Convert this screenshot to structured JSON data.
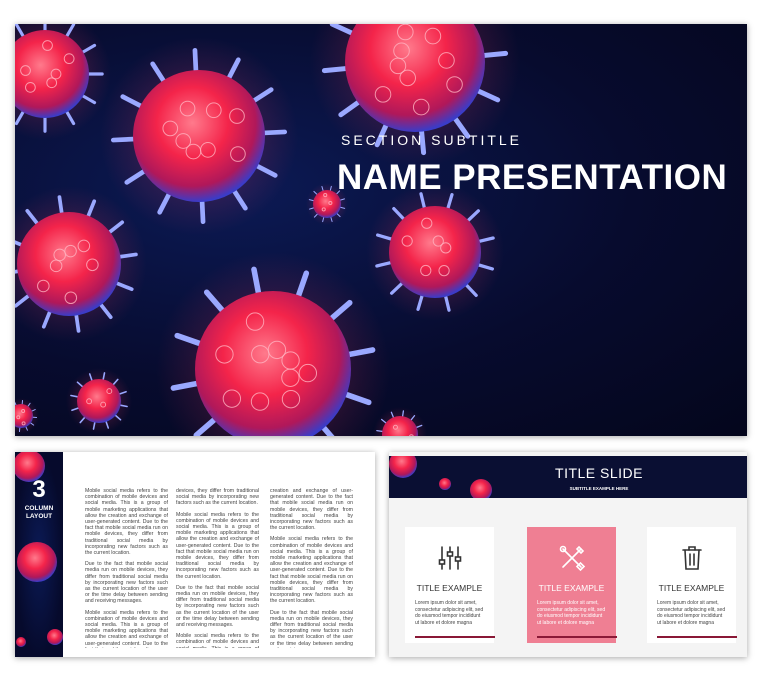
{
  "main_slide": {
    "subtitle": "SECTION SUBTITLE",
    "title": "NAME PRESENTATION"
  },
  "columns_slide": {
    "number": "3",
    "caption_line1": "COLUMN",
    "caption_line2": "LAYOUT",
    "columns": [
      [
        "Mobile social media refers to the combination of mobile devices and social media. This is a group of mobile marketing applications that allow the creation and exchange of user-generated content. Due to the fact that mobile social media run on mobile devices, they differ from traditional social media by incorporating new factors such as the current location.",
        "Due to the fact that mobile social media run on mobile devices, they differ from traditional social media by incorporating new factors such as the current location of the user or the time delay between sending and receiving messages.",
        "Mobile social media refers to the combination of mobile devices and social media. This is a group of mobile marketing applications that allow the creation and exchange of user-generated content. Due to the fact that mobile social media run on mobile"
      ],
      [
        "devices, they differ from traditional social media by incorporating new factors such as the current location.",
        "Mobile social media refers to the combination of mobile devices and social media. This is a group of mobile marketing applications that allow the creation and exchange of user-generated content. Due to the fact that mobile social media run on mobile devices, they differ from traditional social media by incorporating new factors such as the current location.",
        "Due to the fact that mobile social media run on mobile devices, they differ from traditional social media by incorporating new factors such as the current location of the user or the time delay between sending and receiving messages.",
        "Mobile social media refers to the combination of mobile devices and social media. This is a group of mobile marketing applications that allow the"
      ],
      [
        "creation and exchange of user-generated content. Due to the fact that mobile social media run on mobile devices, they differ from traditional social media by incorporating new factors such as the current location.",
        "Mobile social media refers to the combination of mobile devices and social media. This is a group of mobile marketing applications that allow the creation and exchange of user-generated content. Due to the fact that mobile social media run on mobile devices, they differ from traditional social media by incorporating new factors such as the current location.",
        "Due to the fact that mobile social media run on mobile devices, they differ from traditional social media by incorporating new factors such as the current location of the user or the time delay between sending and receiving messages."
      ]
    ]
  },
  "title_slide": {
    "title": "TITLE SLIDE",
    "subtitle": "SUBTITLE EXAMPLE HERE",
    "cards": [
      {
        "icon": "sliders-icon",
        "title": "TITLE EXAMPLE",
        "text": "Lorem ipsum dolor sit amet, consectetur adipiscing elit, sed do eiusmod tempor incididunt ut labore et dolore magna"
      },
      {
        "icon": "tools-icon",
        "title": "TITLE EXAMPLE",
        "text": "Lorem ipsum dolor sit amet, consectetur adipiscing elit, sed do eiusmod tempor incididunt ut labore et dolore magna"
      },
      {
        "icon": "trash-icon",
        "title": "TITLE EXAMPLE",
        "text": "Lorem ipsum dolor sit amet, consectetur adipiscing elit, sed do eiusmod tempor incididunt ut labore et dolore magna"
      }
    ]
  },
  "colors": {
    "background_navy": "#070b2e",
    "virus_red": "#ff3a5c",
    "virus_blue": "#4a6cff",
    "highlight_pink": "#ef7f93",
    "accent_line": "#8a1836"
  }
}
